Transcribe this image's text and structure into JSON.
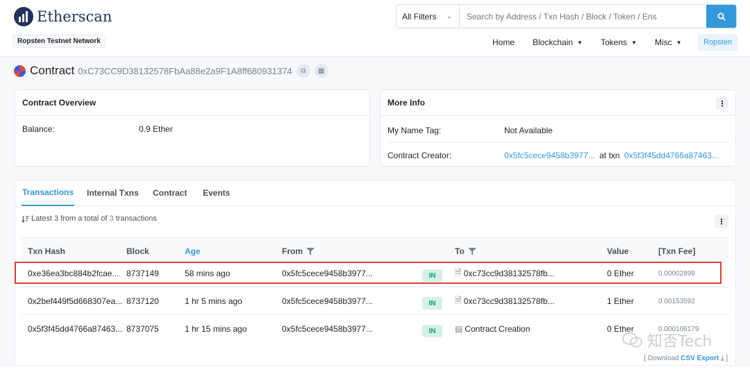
{
  "header": {
    "logo_text": "Etherscan",
    "network": "Ropsten Testnet Network",
    "search": {
      "filter": "All Filters",
      "placeholder": "Search by Address / Txn Hash / Block / Token / Ens"
    },
    "nav": {
      "home": "Home",
      "blockchain": "Blockchain",
      "tokens": "Tokens",
      "misc": "Misc",
      "network_button": "Ropsten"
    }
  },
  "title": {
    "label": "Contract",
    "address": "0xC73CC9D38132578FbAa88e2a9F1A8ff680931374"
  },
  "overview": {
    "heading": "Contract Overview",
    "balance_label": "Balance:",
    "balance_value": "0.9 Ether"
  },
  "more_info": {
    "heading": "More Info",
    "name_tag_label": "My Name Tag:",
    "name_tag_value": "Not Available",
    "creator_label": "Contract Creator:",
    "creator_address": "0x5fc5cece9458b3977...",
    "at_txn": "at txn",
    "creator_txn": "0x5f3f45dd4766a87463..."
  },
  "tabs": [
    "Transactions",
    "Internal Txns",
    "Contract",
    "Events"
  ],
  "summary": {
    "prefix": "Latest 3 from a total of",
    "count": "3",
    "suffix": "transactions"
  },
  "table": {
    "headers": {
      "hash": "Txn Hash",
      "block": "Block",
      "age": "Age",
      "from": "From",
      "to": "To",
      "value": "Value",
      "fee": "[Txn Fee]"
    },
    "rows": [
      {
        "hash": "0xe36ea3bc884b2fcae...",
        "block": "8737149",
        "age": "58 mins ago",
        "from": "0x5fc5cece9458b3977...",
        "dir": "IN",
        "to": "0xc73cc9d38132578fb...",
        "value": "0 Ether",
        "fee": "0.00002899"
      },
      {
        "hash": "0x2bef449f5d668307ea...",
        "block": "8737120",
        "age": "1 hr 5 mins ago",
        "from": "0x5fc5cece9458b3977...",
        "dir": "IN",
        "to": "0xc73cc9d38132578fb...",
        "value": "1 Ether",
        "fee": "0.00153592"
      },
      {
        "hash": "0x5f3f45dd4766a87463...",
        "block": "8737075",
        "age": "1 hr 15 mins ago",
        "from": "0x5fc5cece9458b3977...",
        "dir": "IN",
        "to": "Contract Creation",
        "value": "0 Ether",
        "fee": "0.000106179"
      }
    ]
  },
  "footer": {
    "download_prefix": "[ Download",
    "csv": "CSV Export",
    "download_suffix": "]"
  },
  "watermark": "知否Tech",
  "colors": {
    "brand": "#21325b",
    "link": "#3498db",
    "in_badge_bg": "#d4f1e9",
    "in_badge_text": "#00a186",
    "highlight": "#e53935"
  }
}
